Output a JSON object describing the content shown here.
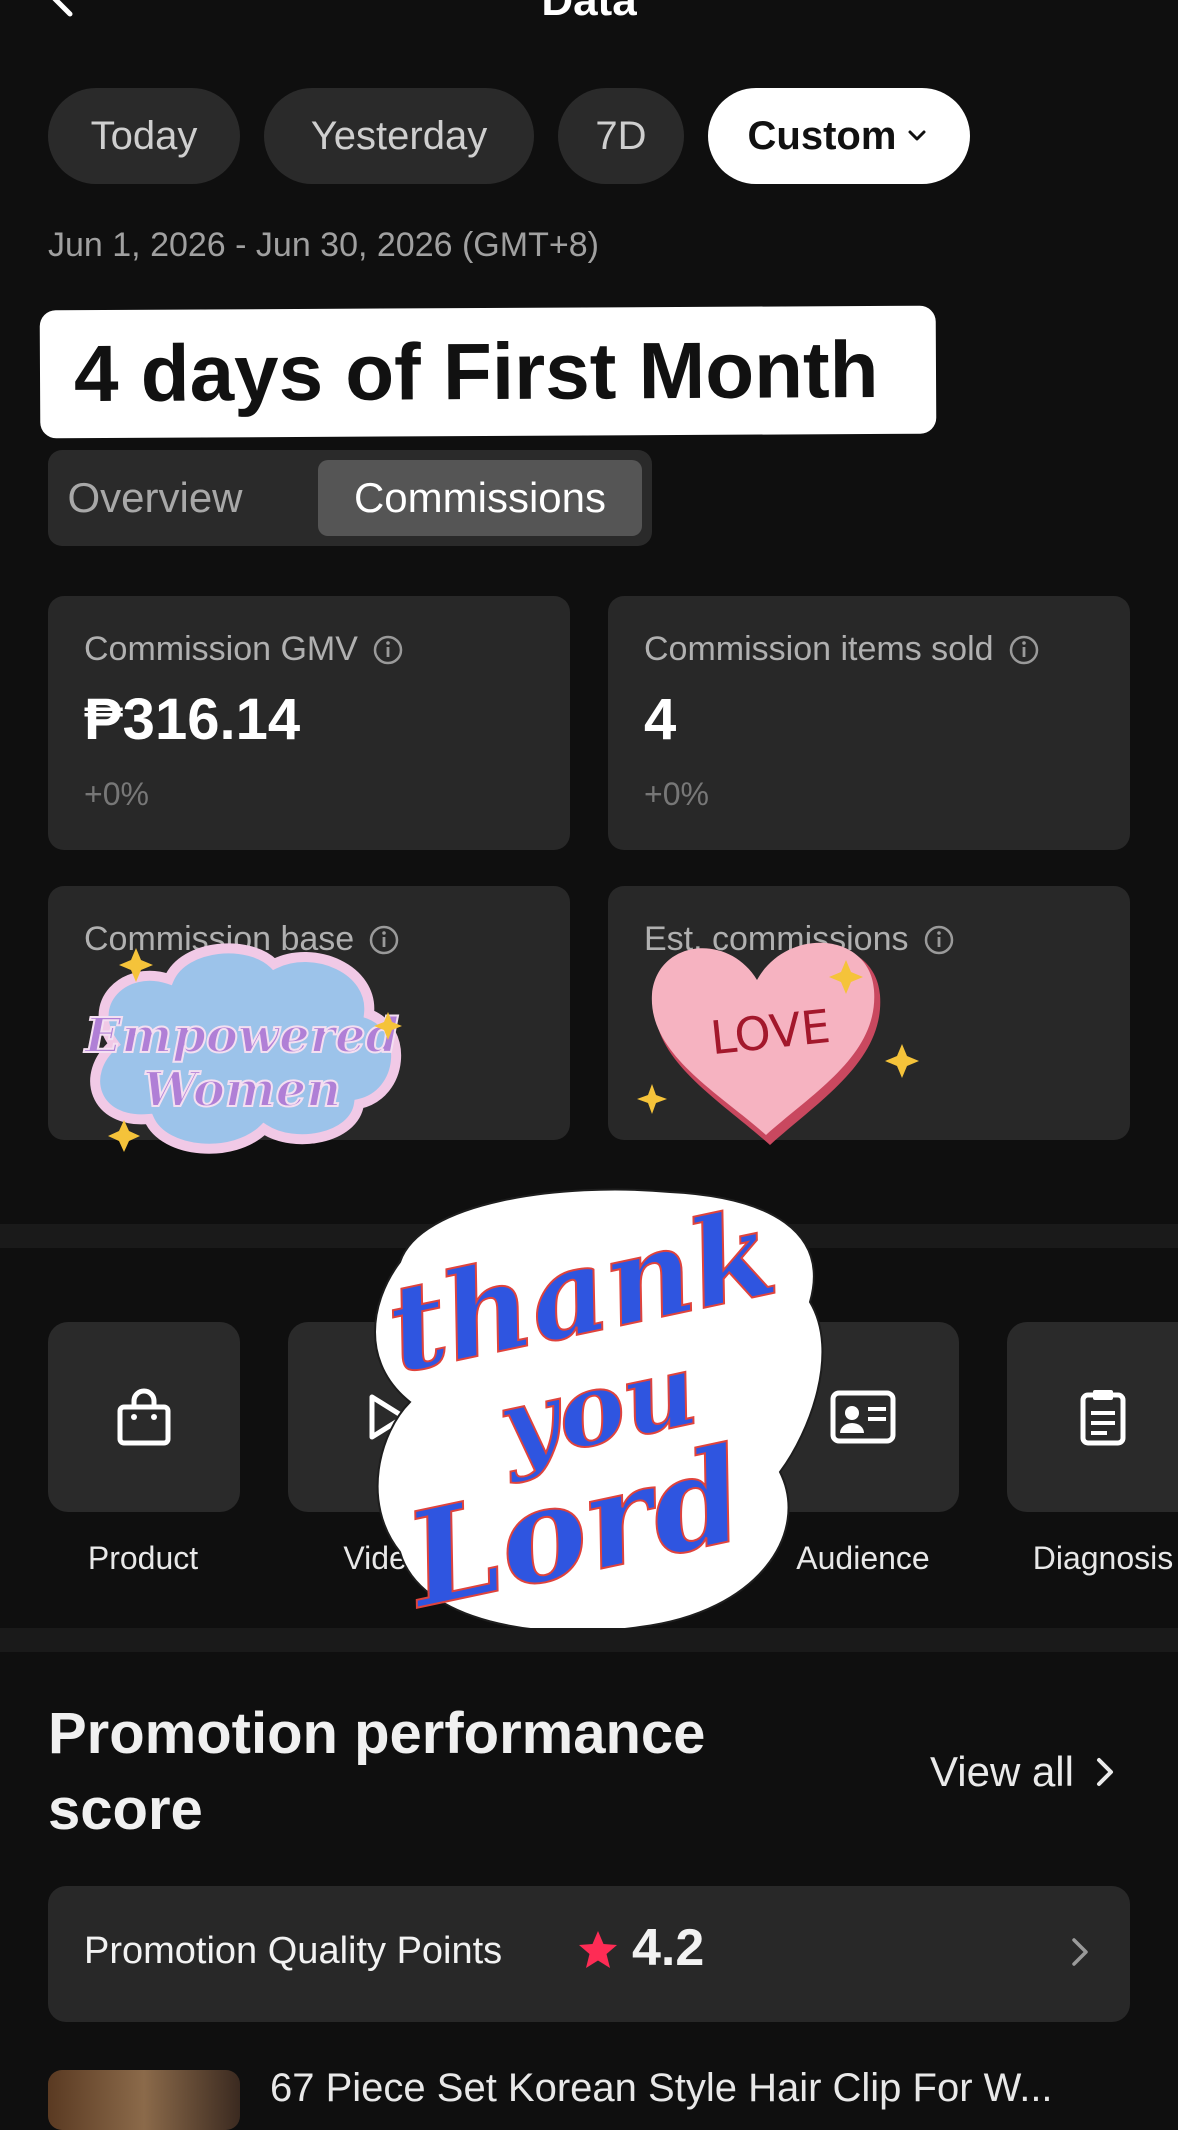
{
  "header": {
    "title": "Data"
  },
  "date_filters": {
    "options": [
      "Today",
      "Yesterday",
      "7D",
      "Custom"
    ],
    "selected": "Custom"
  },
  "date_range": "Jun 1, 2026 - Jun 30, 2026 (GMT+8)",
  "banner_text": "4 days of First Month",
  "tabs": {
    "overview": "Overview",
    "commissions": "Commissions",
    "selected": "Commissions"
  },
  "metrics": {
    "gmv": {
      "label": "Commission GMV",
      "value": "₱316.14",
      "change": "+0%"
    },
    "items_sold": {
      "label": "Commission items sold",
      "value": "4",
      "change": "+0%"
    },
    "base": {
      "label": "Commission base"
    },
    "est": {
      "label": "Est. commissions"
    }
  },
  "tools": {
    "product": "Product",
    "video": "Video",
    "audience": "Audience",
    "diagnosis": "Diagnosis"
  },
  "stickers": {
    "empowered_line1": "Empowered",
    "empowered_line2": "Women",
    "love": "LOVE",
    "thank": "thank",
    "you": "you",
    "lord": "Lord"
  },
  "promotion": {
    "title": "Promotion performance score",
    "view_all": "View all",
    "quality_label": "Promotion Quality Points",
    "quality_score": "4.2"
  },
  "product_preview": {
    "title": "67 Piece Set Korean Style Hair Clip For W..."
  },
  "colors": {
    "background": "#0f0f0f",
    "card": "#282828",
    "star": "#fe2c55",
    "sticker_blue": "#2f55e0",
    "sticker_red": "#e0433c"
  }
}
